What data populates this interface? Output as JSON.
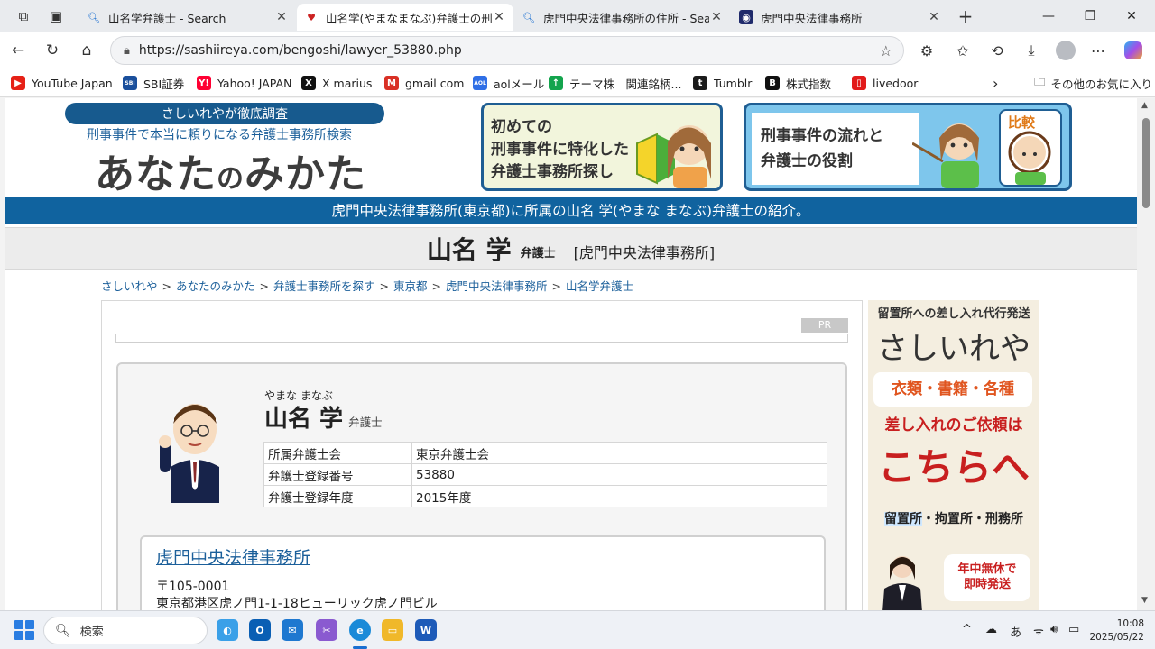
{
  "browser": {
    "tabs": [
      {
        "title": "山名学弁護士 - Search",
        "active": false
      },
      {
        "title": "山名学(やまなまなぶ)弁護士の刑事",
        "active": true
      },
      {
        "title": "虎門中央法律事務所の住所 - Sea",
        "active": false
      },
      {
        "title": "虎門中央法律事務所",
        "active": false
      }
    ],
    "url": "https://sashiireya.com/bengoshi/lawyer_53880.php",
    "bookmarks": [
      {
        "label": "YouTube Japan",
        "icon": "youtube-icon",
        "color": "#e62117",
        "glyph": "▶"
      },
      {
        "label": "SBI証券",
        "icon": "sbi-icon",
        "color": "#1a4f9c",
        "glyph": "SBI"
      },
      {
        "label": "Yahoo! JAPAN",
        "icon": "yahoo-icon",
        "color": "#ff0033",
        "glyph": "Y!"
      },
      {
        "label": "X marius",
        "icon": "x-icon",
        "color": "#111111",
        "glyph": "X"
      },
      {
        "label": "gmail com",
        "icon": "gmail-icon",
        "color": "#d93025",
        "glyph": "M"
      },
      {
        "label": "aolメール",
        "icon": "aol-icon",
        "color": "#2f6fe6",
        "glyph": "AOL"
      },
      {
        "label": "テーマ株　関連銘柄...",
        "icon": "theme-stock-icon",
        "color": "#14a44d",
        "glyph": "↑"
      },
      {
        "label": "Tumblr",
        "icon": "tumblr-icon",
        "color": "#1b1b1b",
        "glyph": "t"
      },
      {
        "label": "株式指数",
        "icon": "b-icon",
        "color": "#111111",
        "glyph": "B"
      },
      {
        "label": "livedoor",
        "icon": "livedoor-icon",
        "color": "#e21b1b",
        "glyph": "▯"
      }
    ],
    "other_favorites": "その他のお気に入り"
  },
  "site": {
    "pill": "さしいれやが徹底調査",
    "tagline": "刑事事件で本当に頼りになる弁護士事務所検索",
    "logo_main": "あなた",
    "logo_small": "の",
    "logo_rest": "みかた",
    "banner1": "初めての\n刑事事件に特化した\n弁護士事務所探し",
    "banner2": "刑事事件の流れと\n弁護士の役割",
    "banner2_badge": "比較",
    "intro": "虎門中央法律事務所(東京都)に所属の山名 学(やまな まなぶ)弁護士の紹介。",
    "name": "山名 学",
    "role": "弁護士",
    "firm": "[虎門中央法律事務所]"
  },
  "breadcrumbs": [
    "さしいれや",
    "あなたのみかた",
    "弁護士事務所を探す",
    "東京都",
    "虎門中央法律事務所",
    "山名学弁護士"
  ],
  "profile": {
    "pr": "PR",
    "kana": "やまな まなぶ",
    "name": "山名 学",
    "title": "弁護士",
    "rows": [
      {
        "key": "所属弁護士会",
        "value": "東京弁護士会"
      },
      {
        "key": "弁護士登録番号",
        "value": "53880"
      },
      {
        "key": "弁護士登録年度",
        "value": "2015年度"
      }
    ]
  },
  "office": {
    "name": "虎門中央法律事務所",
    "zip": "〒105-0001",
    "address": "東京都港区虎ノ門1-1-18ヒューリック虎ノ門ビル"
  },
  "ad": {
    "line1": "留置所への差し入れ代行発送",
    "brand": "さしいれや",
    "items": "衣類・書籍・各種",
    "request": "差し入れのご依頼は",
    "here": "こちらへ",
    "places_hl": "留置所",
    "places_rest": "・拘置所・刑務所",
    "badge": "年中無休で\n即時発送"
  },
  "taskbar": {
    "search_placeholder": "検索",
    "ime": "あ",
    "time": "10:08",
    "date": "2025/05/22"
  }
}
